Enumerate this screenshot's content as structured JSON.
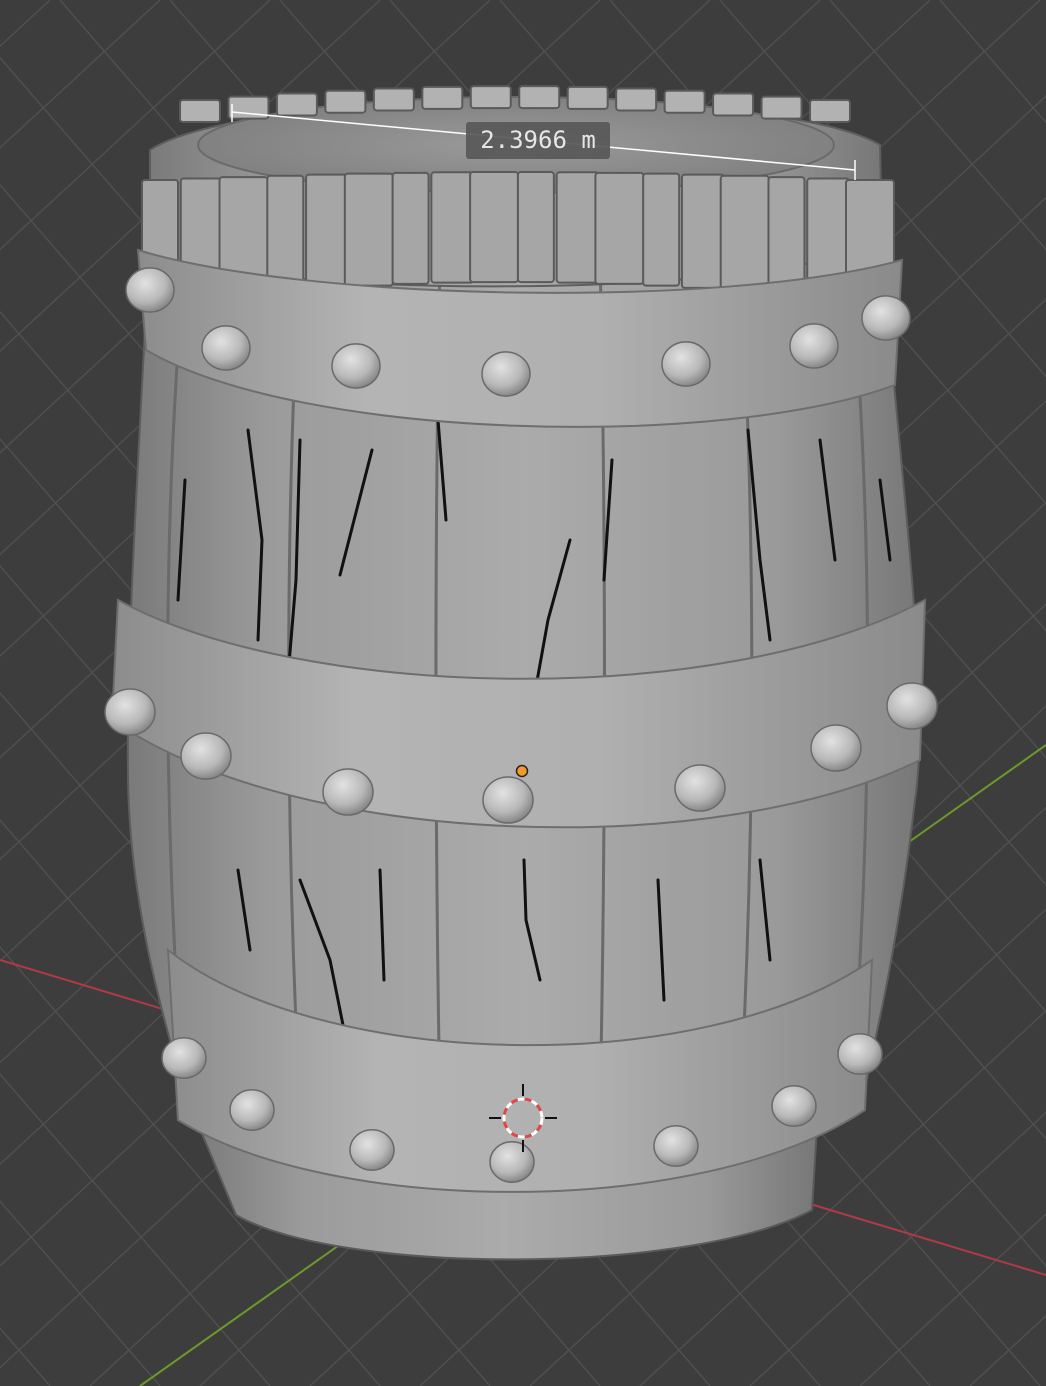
{
  "viewport": {
    "background": "#3d3d3d",
    "grid_color": "#505050",
    "axis_x_color": "#b03a48",
    "axis_y_color": "#6b9a2a"
  },
  "measurement": {
    "label": "2.3966 m",
    "line_color": "#ffffff"
  },
  "object": {
    "type": "barrel-mesh",
    "base_color": "#a2a2a2",
    "band_color": "#adadad",
    "rivet_color": "#c2c2c2",
    "crack_color": "#111111",
    "origin_color": "#f39a2b"
  },
  "cursor_3d": {
    "icon": "3d-cursor-icon",
    "ring_color": "#e04848"
  }
}
